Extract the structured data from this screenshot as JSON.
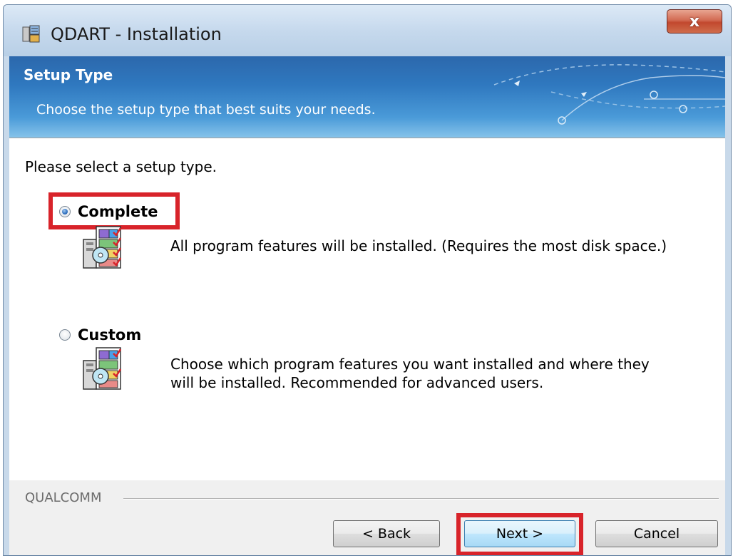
{
  "window": {
    "title": "QDART - Installation",
    "close_glyph": "x"
  },
  "banner": {
    "title": "Setup Type",
    "subtitle": "Choose the setup type that best suits your needs."
  },
  "content": {
    "prompt": "Please select a setup type.",
    "options": [
      {
        "label": "Complete",
        "selected": true,
        "description": "All program features will be installed. (Requires the most disk space.)",
        "icon": "setup-complete-icon"
      },
      {
        "label": "Custom",
        "selected": false,
        "description_line1": "Choose which program features you want installed and where they",
        "description_line2": "will be installed. Recommended for advanced users.",
        "icon": "setup-custom-icon"
      }
    ]
  },
  "footer": {
    "brand": "QUALCOMM",
    "back_label": "< Back",
    "next_label": "Next >",
    "cancel_label": "Cancel"
  },
  "colors": {
    "highlight": "#d8232a",
    "banner": "#2f78bf",
    "close_button": "#c2482e"
  }
}
